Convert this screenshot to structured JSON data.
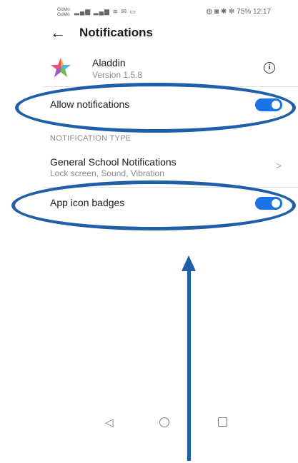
{
  "status_bar": {
    "carrier": "GoMo GoMo",
    "right_text": "75% 12:17"
  },
  "header": {
    "back_icon": "arrow-left-icon",
    "title": "Notifications"
  },
  "app": {
    "name": "Aladdin",
    "version": "Version 1.5.8",
    "info_icon": "info-icon"
  },
  "settings": {
    "allow_notifications": {
      "label": "Allow notifications",
      "enabled": true
    },
    "section_header": "NOTIFICATION TYPE",
    "general_school": {
      "label": "General School Notifications",
      "sub": "Lock screen, Sound, Vibration"
    },
    "app_icon_badges": {
      "label": "App icon badges",
      "enabled": true
    }
  },
  "colors": {
    "toggle_on": "#1a73e8",
    "annotation": "#1f5ea8"
  }
}
